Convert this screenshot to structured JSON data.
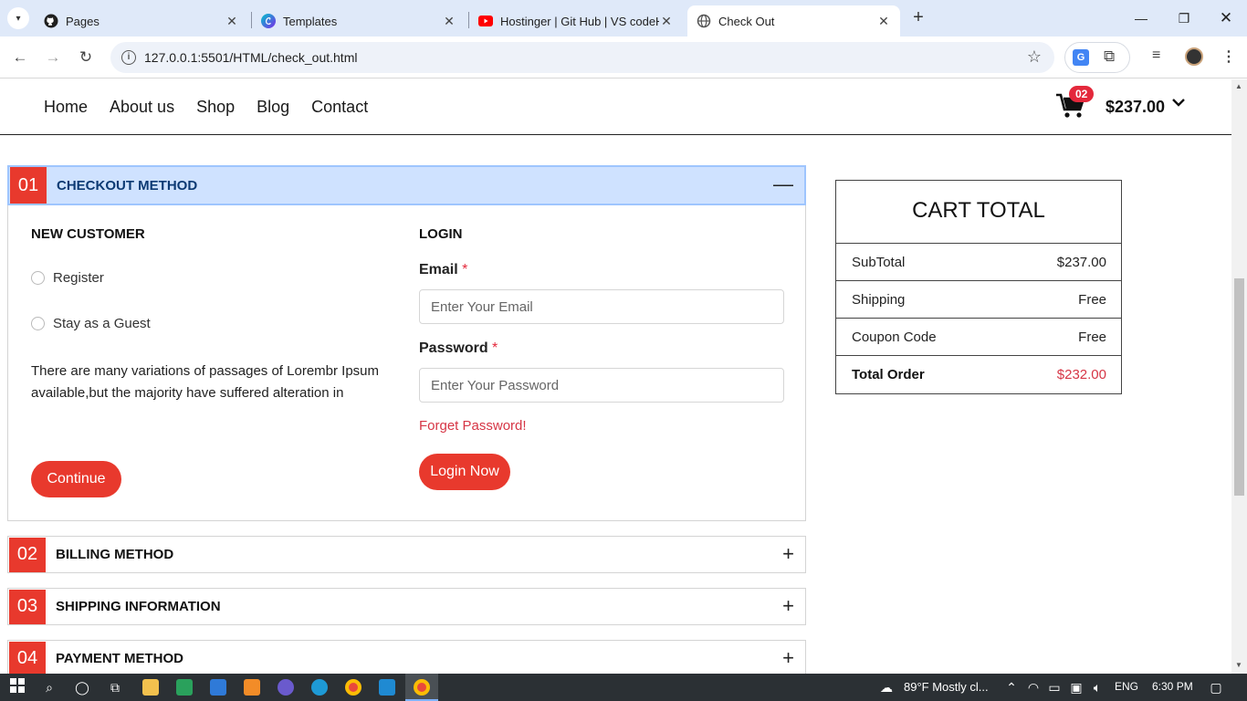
{
  "browser": {
    "tabs": [
      {
        "title": "Pages",
        "icon": "github-icon"
      },
      {
        "title": "Templates",
        "icon": "canva-icon"
      },
      {
        "title": "Hostinger | Git Hub | VS codeHo",
        "icon": "youtube-icon"
      },
      {
        "title": "Check Out",
        "icon": "globe-icon",
        "active": true
      }
    ],
    "url": "127.0.0.1:5501/HTML/check_out.html"
  },
  "nav": {
    "items": [
      "Home",
      "About us",
      "Shop",
      "Blog",
      "Contact"
    ],
    "cart_count": "02",
    "cart_amount": "$237.00"
  },
  "checkout": {
    "steps": [
      {
        "num": "01",
        "title": "CHECKOUT METHOD",
        "open": true
      },
      {
        "num": "02",
        "title": "BILLING METHOD"
      },
      {
        "num": "03",
        "title": "SHIPPING INFORMATION"
      },
      {
        "num": "04",
        "title": "PAYMENT METHOD"
      }
    ],
    "new_customer": {
      "heading": "NEW CUSTOMER",
      "options": [
        "Register",
        "Stay as a Guest"
      ],
      "description": "There are many variations of passages of Lorembr Ipsum available,but the majority have suffered alteration in",
      "continue_label": "Continue"
    },
    "login": {
      "heading": "LOGIN",
      "email_label": "Email",
      "email_placeholder": "Enter Your Email",
      "password_label": "Password",
      "password_placeholder": "Enter Your Password",
      "required_mark": "*",
      "forgot_label": "Forget Password!",
      "login_label": "Login Now"
    }
  },
  "cart_total": {
    "title": "CART TOTAL",
    "rows": [
      {
        "label": "SubTotal",
        "value": "$237.00"
      },
      {
        "label": "Shipping",
        "value": "Free"
      },
      {
        "label": "Coupon Code",
        "value": "Free"
      },
      {
        "label": "Total Order",
        "value": "$232.00"
      }
    ]
  },
  "taskbar": {
    "weather": "89°F  Mostly cl...",
    "lang": "ENG",
    "time": "6:30 PM"
  },
  "colors": {
    "accent": "#e8392d",
    "header_open_bg": "#cfe2ff",
    "price_red": "#d63545"
  }
}
